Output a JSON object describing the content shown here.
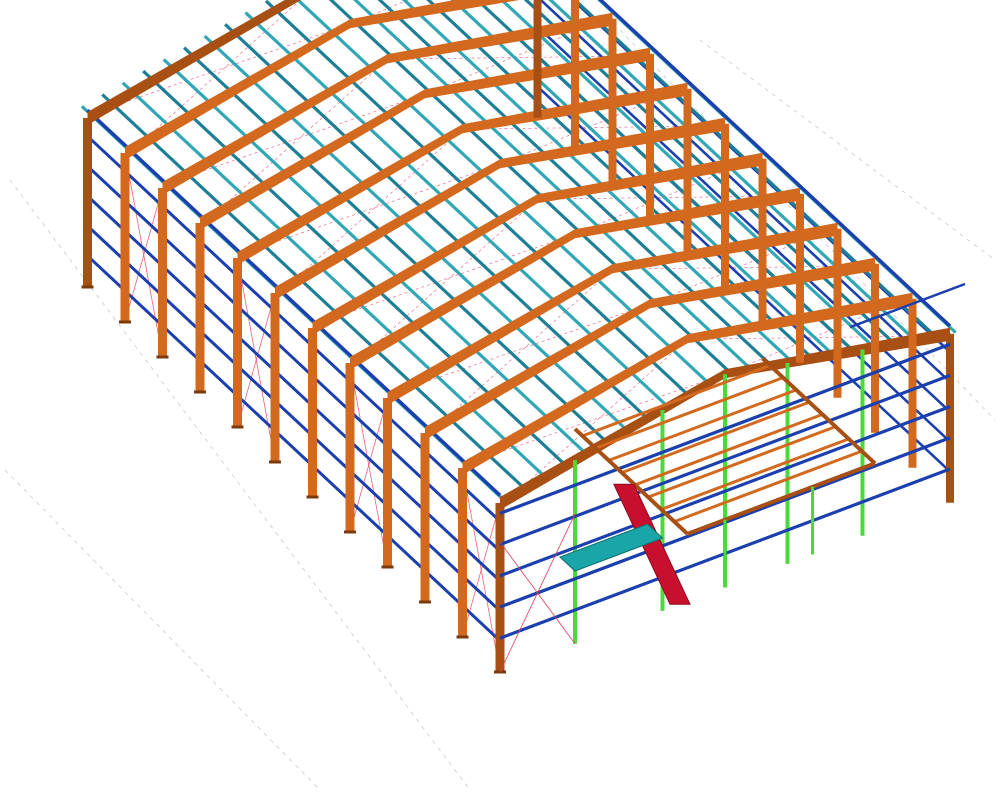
{
  "view": {
    "background": "#ffffff"
  },
  "model": {
    "frame_count": 12,
    "purlin_count": 22,
    "girt_rows": 5
  },
  "colors": {
    "primary_frame": "#d2691e",
    "primary_frame_dark": "#a84f14",
    "purlin": "#1d7f96",
    "purlin_light": "#31a7b6",
    "girt": "#1b3fae",
    "end_post": "#4cd93c",
    "bracing": "#e33b5a",
    "grid": "#c9c9c9",
    "stair": "#c8102e",
    "platform": "#1aa5a8"
  }
}
